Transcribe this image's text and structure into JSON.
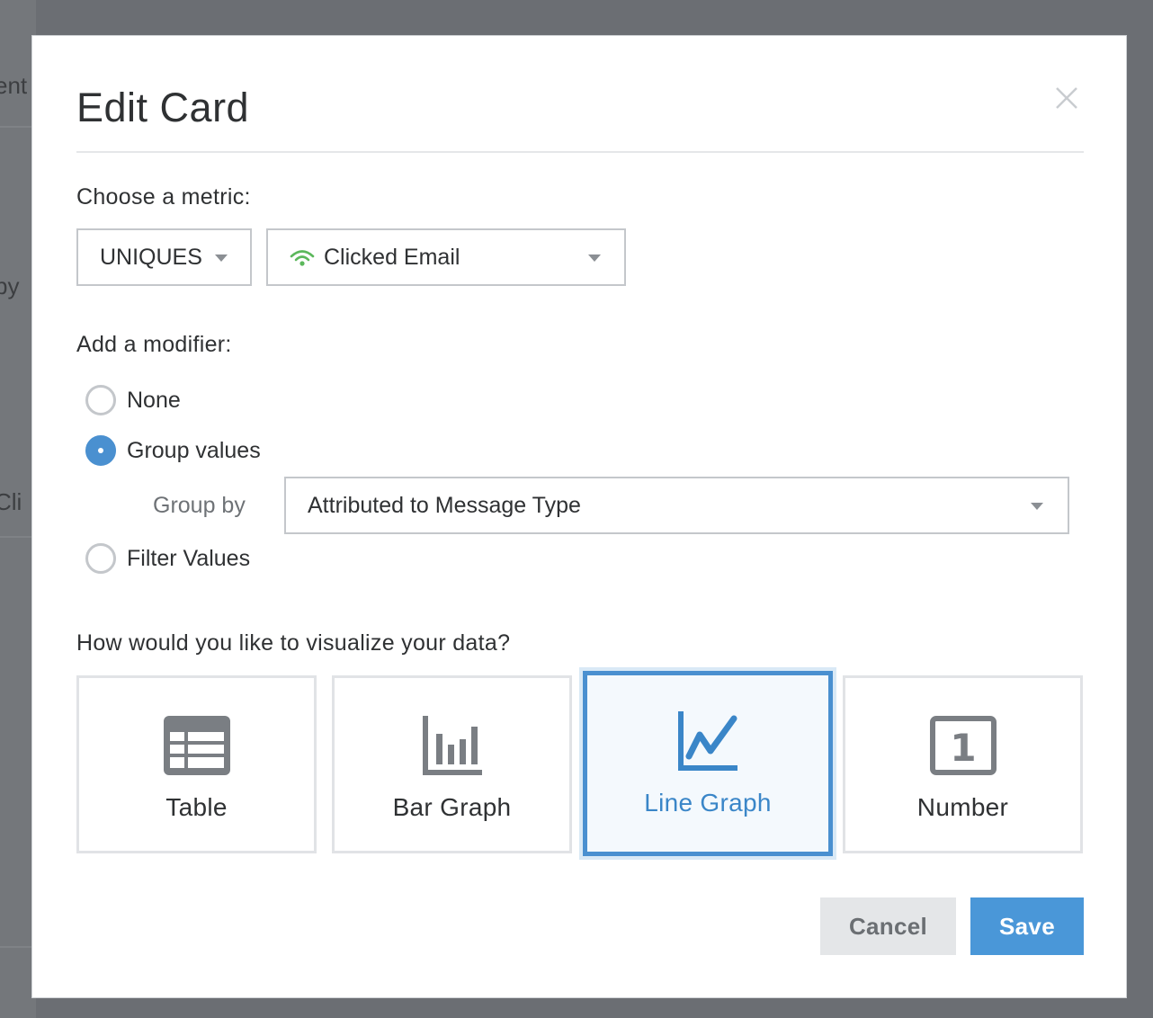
{
  "background": {
    "fragment_1": "ent",
    "fragment_2": "by",
    "fragment_3": "Cli"
  },
  "modal": {
    "title": "Edit Card",
    "close_icon": "close-icon"
  },
  "metric": {
    "label": "Choose a metric:",
    "aggregation": "UNIQUES",
    "event": "Clicked Email",
    "event_icon": "wifi-signal-icon"
  },
  "modifier": {
    "label": "Add a modifier:",
    "options": [
      {
        "label": "None",
        "checked": false
      },
      {
        "label": "Group values",
        "checked": true
      },
      {
        "label": "Filter Values",
        "checked": false
      }
    ],
    "group_by_label": "Group by",
    "group_by_value": "Attributed to Message Type"
  },
  "visualization": {
    "label": "How would you like to visualize your data?",
    "options": [
      {
        "label": "Table",
        "icon": "table-icon",
        "selected": false
      },
      {
        "label": "Bar Graph",
        "icon": "bar-graph-icon",
        "selected": false
      },
      {
        "label": "Line Graph",
        "icon": "line-graph-icon",
        "selected": true
      },
      {
        "label": "Number",
        "icon": "number-icon",
        "selected": false
      }
    ]
  },
  "actions": {
    "cancel": "Cancel",
    "save": "Save"
  },
  "colors": {
    "accent": "#4a90d0",
    "save_button": "#4a97d8",
    "event_icon": "#5cb85c"
  }
}
